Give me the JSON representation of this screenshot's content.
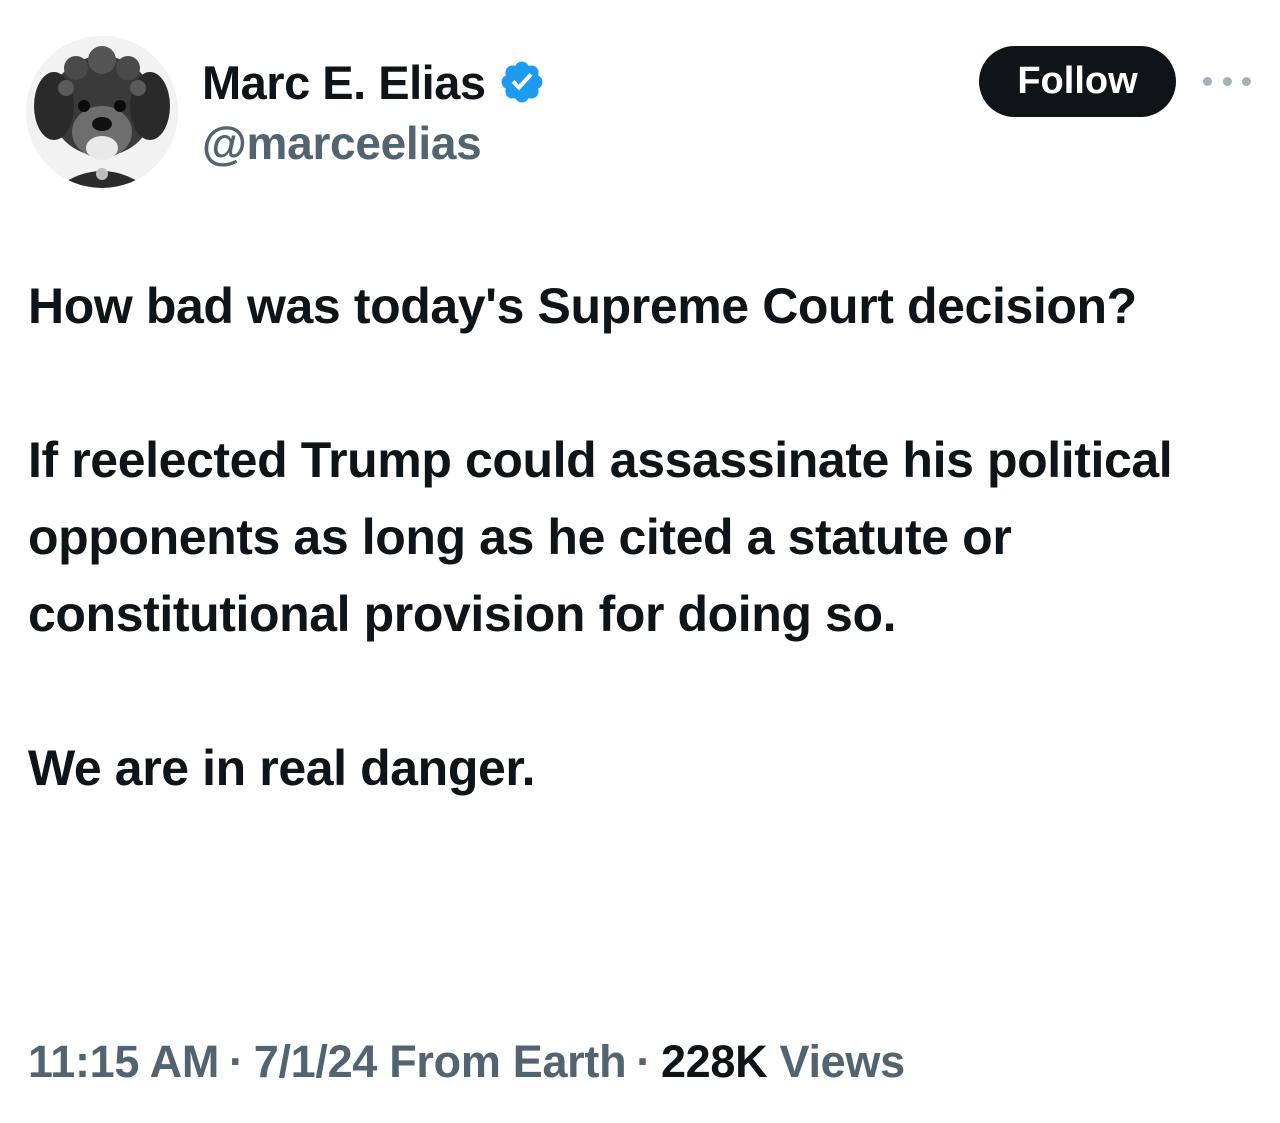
{
  "author": {
    "display_name": "Marc E. Elias",
    "handle": "@marceelias",
    "verified": true,
    "verified_color": "#1d9bf0",
    "avatar_icon": "dog-avatar"
  },
  "actions": {
    "follow_label": "Follow",
    "more_icon": "more-horizontal-icon"
  },
  "tweet": {
    "paragraphs": [
      "How bad was today's Supreme Court decision?",
      "If reelected Trump could assassinate his political opponents as long as he cited a statute or constitutional provision for doing so.",
      "We are in real danger."
    ]
  },
  "meta": {
    "time": "11:15 AM",
    "separator": "·",
    "date": "7/1/24",
    "source": "From Earth",
    "views_count": "228K",
    "views_label": "Views"
  },
  "colors": {
    "text_primary": "#0f1419",
    "text_secondary": "#536471",
    "follow_bg": "#0f1419",
    "follow_text": "#ffffff"
  }
}
